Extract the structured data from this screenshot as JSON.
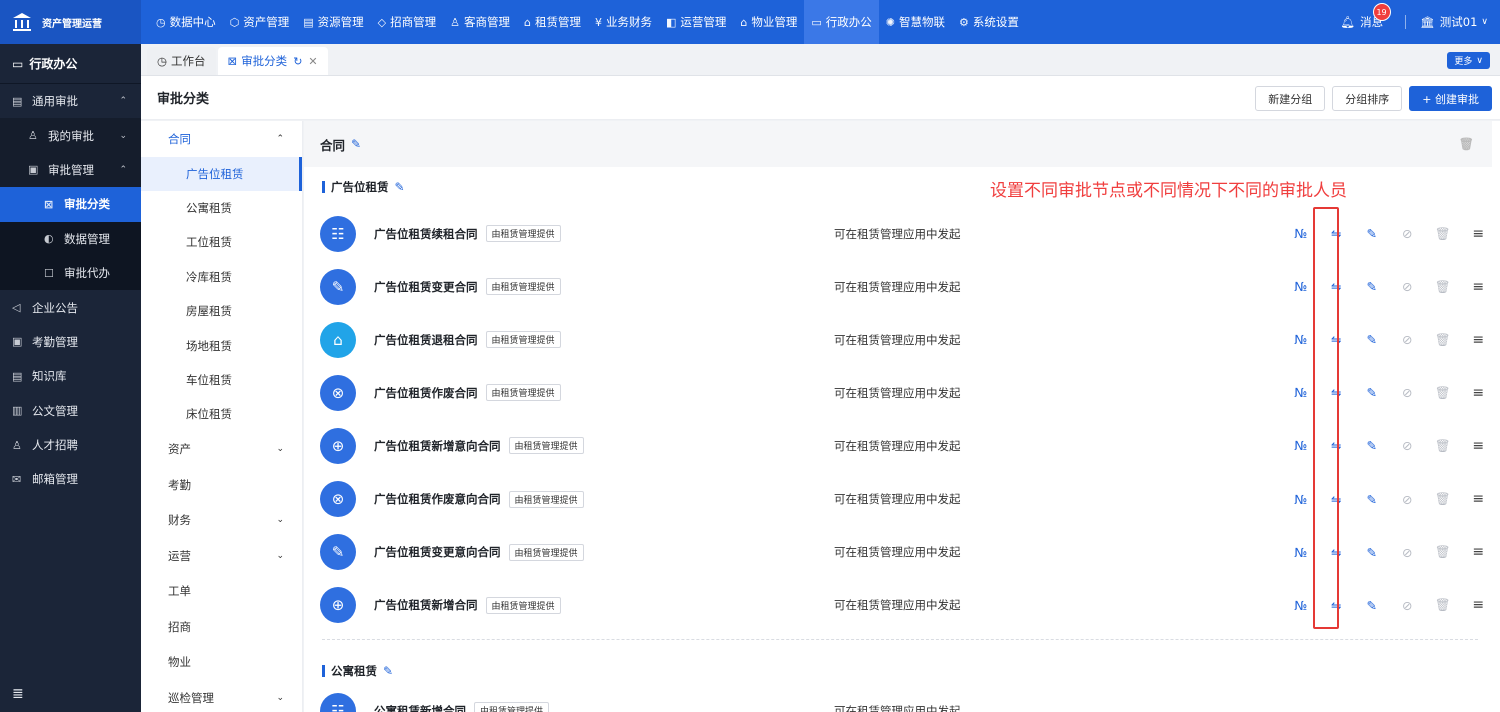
{
  "brand": {
    "name": "资产管理运营"
  },
  "nav": [
    {
      "icon": "◷",
      "label": "数据中心"
    },
    {
      "icon": "⬡",
      "label": "资产管理"
    },
    {
      "icon": "▤",
      "label": "资源管理"
    },
    {
      "icon": "◇",
      "label": "招商管理"
    },
    {
      "icon": "♙",
      "label": "客商管理"
    },
    {
      "icon": "⌂",
      "label": "租赁管理"
    },
    {
      "icon": "¥",
      "label": "业务财务"
    },
    {
      "icon": "◧",
      "label": "运营管理"
    },
    {
      "icon": "⌂",
      "label": "物业管理"
    },
    {
      "icon": "▭",
      "label": "行政办公",
      "active": true
    },
    {
      "icon": "✺",
      "label": "智慧物联"
    },
    {
      "icon": "⚙",
      "label": "系统设置"
    }
  ],
  "topright": {
    "message_label": "消息",
    "message_count": "19",
    "user_name": "测试01"
  },
  "sidebar": {
    "title": "行政办公",
    "items": [
      {
        "label": "通用审批",
        "level": 1,
        "icon": "▤",
        "arrow": "⌃"
      },
      {
        "label": "我的审批",
        "level": 2,
        "icon": "♙",
        "arrow": "⌄"
      },
      {
        "label": "审批管理",
        "level": 2,
        "icon": "▣",
        "arrow": "⌃"
      },
      {
        "label": "审批分类",
        "level": 3,
        "icon": "⊠",
        "active": true
      },
      {
        "label": "数据管理",
        "level": 3,
        "icon": "◐"
      },
      {
        "label": "审批代办",
        "level": 3,
        "icon": "☐"
      },
      {
        "label": "企业公告",
        "level": 1,
        "icon": "◁"
      },
      {
        "label": "考勤管理",
        "level": 1,
        "icon": "▣"
      },
      {
        "label": "知识库",
        "level": 1,
        "icon": "▤"
      },
      {
        "label": "公文管理",
        "level": 1,
        "icon": "▥"
      },
      {
        "label": "人才招聘",
        "level": 1,
        "icon": "♙"
      },
      {
        "label": "邮箱管理",
        "level": 1,
        "icon": "✉"
      }
    ]
  },
  "tabs": [
    {
      "icon": "◷",
      "label": "工作台",
      "active": false
    },
    {
      "icon": "⊠",
      "label": "审批分类",
      "active": true
    }
  ],
  "more_label": "更多",
  "page": {
    "title": "审批分类",
    "btn_new_group": "新建分组",
    "btn_sort_group": "分组排序",
    "btn_create": "+ 创建审批"
  },
  "categories": [
    {
      "label": "合同",
      "open": true,
      "arrow": "⌃",
      "children": [
        "广告位租赁",
        "公寓租赁",
        "工位租赁",
        "冷库租赁",
        "房屋租赁",
        "场地租赁",
        "车位租赁",
        "床位租赁"
      ]
    },
    {
      "label": "资产",
      "arrow": "⌄"
    },
    {
      "label": "考勤"
    },
    {
      "label": "财务",
      "arrow": "⌄"
    },
    {
      "label": "运营",
      "arrow": "⌄"
    },
    {
      "label": "工单"
    },
    {
      "label": "招商"
    },
    {
      "label": "物业"
    },
    {
      "label": "巡检管理",
      "arrow": "⌄"
    }
  ],
  "content": {
    "group_title": "合同",
    "section_title": "广告位租赁",
    "annotation": "设置不同审批节点或不同情况下不同的审批人员",
    "rows": [
      {
        "name": "广告位租赁续租合同",
        "tag": "由租赁管理提供",
        "desc": "可在租赁管理应用中发起",
        "icon": "☷",
        "color": "blue"
      },
      {
        "name": "广告位租赁变更合同",
        "tag": "由租赁管理提供",
        "desc": "可在租赁管理应用中发起",
        "icon": "✎",
        "color": "blue"
      },
      {
        "name": "广告位租赁退租合同",
        "tag": "由租赁管理提供",
        "desc": "可在租赁管理应用中发起",
        "icon": "⌂",
        "color": "cyan"
      },
      {
        "name": "广告位租赁作废合同",
        "tag": "由租赁管理提供",
        "desc": "可在租赁管理应用中发起",
        "icon": "⊗",
        "color": "blue"
      },
      {
        "name": "广告位租赁新增意向合同",
        "tag": "由租赁管理提供",
        "desc": "可在租赁管理应用中发起",
        "icon": "⊕",
        "color": "blue"
      },
      {
        "name": "广告位租赁作废意向合同",
        "tag": "由租赁管理提供",
        "desc": "可在租赁管理应用中发起",
        "icon": "⊗",
        "color": "blue"
      },
      {
        "name": "广告位租赁变更意向合同",
        "tag": "由租赁管理提供",
        "desc": "可在租赁管理应用中发起",
        "icon": "✎",
        "color": "blue"
      },
      {
        "name": "广告位租赁新增合同",
        "tag": "由租赁管理提供",
        "desc": "可在租赁管理应用中发起",
        "icon": "⊕",
        "color": "blue"
      }
    ],
    "actions": {
      "number": "№",
      "flow": "⇋",
      "edit": "✎",
      "disable": "⊘",
      "delete": "🗑",
      "menu": "≡"
    },
    "section2_title": "公寓租赁",
    "row_cut": {
      "name": "公寓租赁新增合同",
      "tag": "由租赁管理提供",
      "desc": "可在租赁管理应用中发起"
    }
  }
}
